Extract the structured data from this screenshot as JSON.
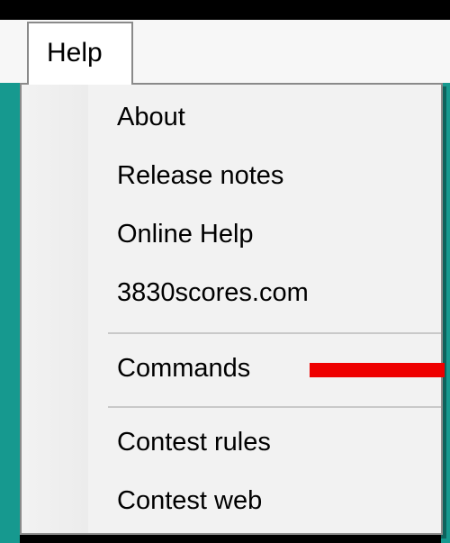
{
  "menubar": {
    "help_label": "Help"
  },
  "help_menu": {
    "items": [
      {
        "label": "About"
      },
      {
        "label": "Release notes"
      },
      {
        "label": "Online Help"
      },
      {
        "label": "3830scores.com"
      },
      {
        "label": "Commands"
      },
      {
        "label": "Contest rules"
      },
      {
        "label": "Contest web"
      }
    ]
  },
  "colors": {
    "background": "#000000",
    "window_teal": "#16998f",
    "menu_bg": "#f2f2f2",
    "menu_border": "#8a8a8a",
    "separator": "#c9c9c9",
    "annotation_arrow": "#ee0000"
  }
}
